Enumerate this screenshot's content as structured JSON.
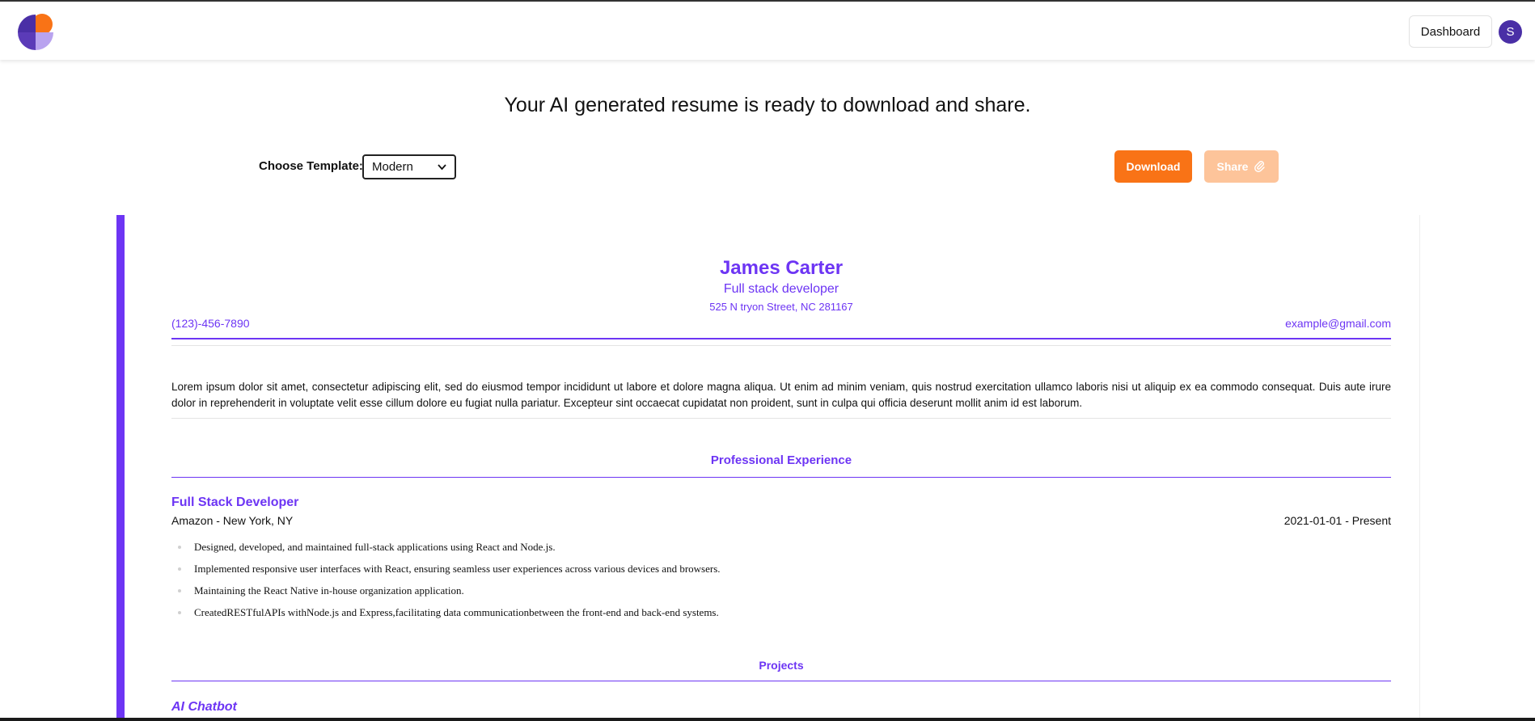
{
  "navbar": {
    "dashboard_label": "Dashboard",
    "avatar_initial": "S"
  },
  "page": {
    "headline": "Your AI generated resume is ready to download and share."
  },
  "controls": {
    "template_label": "Choose Template:",
    "template_selected": "Modern",
    "download_label": "Download",
    "share_label": "Share"
  },
  "resume": {
    "name": "James Carter",
    "role": "Full stack developer",
    "address": "525 N tryon Street, NC 281167",
    "phone": "(123)-456-7890",
    "email": "example@gmail.com",
    "summary": "Lorem ipsum dolor sit amet, consectetur adipiscing elit, sed do eiusmod tempor incididunt ut labore et dolore magna aliqua. Ut enim ad minim veniam, quis nostrud exercitation ullamco laboris nisi ut aliquip ex ea commodo consequat. Duis aute irure dolor in reprehenderit in voluptate velit esse cillum dolore eu fugiat nulla pariatur. Excepteur sint occaecat cupidatat non proident, sunt in culpa qui officia deserunt mollit anim id est laborum.",
    "experience_heading": "Professional Experience",
    "job": {
      "title": "Full Stack Developer",
      "company": "Amazon - New York, NY",
      "dates": "2021-01-01 - Present",
      "bullets": [
        "Designed, developed, and maintained full-stack applications using React and Node.js.",
        "Implemented responsive user interfaces with React, ensuring seamless user experiences across various devices and browsers.",
        "Maintaining the React Native in-house organization application.",
        "CreatedRESTfulAPIs withNode.js and Express,facilitating data communicationbetween the front-end and back-end systems."
      ]
    },
    "projects_heading": "Projects",
    "project_title": "AI Chatbot"
  },
  "colors": {
    "accent": "#6d35f4",
    "download": "#f97316",
    "share_disabled": "#fdc49a",
    "avatar": "#4a2fa6"
  },
  "icons": {
    "logo": "app-logo-icon",
    "share": "paperclip-icon",
    "select": "chevron-down-icon"
  }
}
